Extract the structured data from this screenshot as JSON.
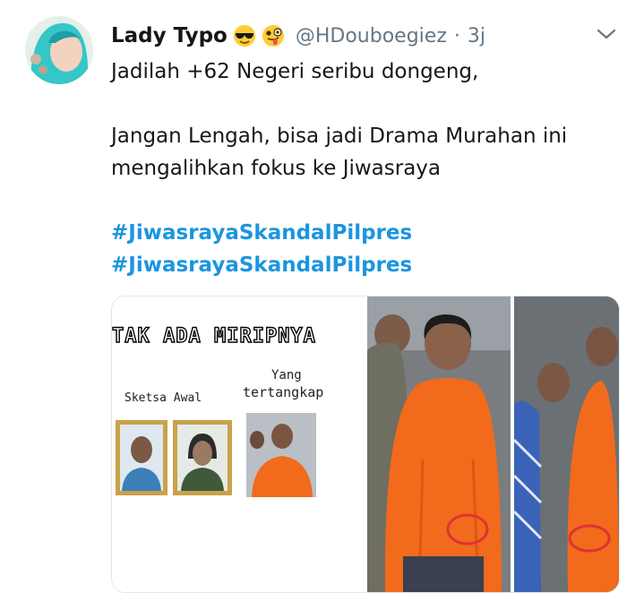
{
  "tweet": {
    "display_name": "Lady Typo",
    "emojis": [
      "sunglasses-emoji",
      "winking-tongue-emoji"
    ],
    "handle": "@HDouboegiez",
    "separator": "·",
    "time": "3j",
    "lines": [
      "Jadilah +62 Negeri seribu dongeng,",
      "",
      "Jangan Lengah, bisa jadi Drama Murahan ini",
      "mengalihkan fokus ke Jiwasraya",
      ""
    ],
    "hashtags": [
      "#JiwasrayaSkandalPilpres",
      "#JiwasrayaSkandalPilpres"
    ]
  },
  "media": {
    "meme_title": "TAK ADA MIRIPNYA",
    "meme_label_left": "Sketsa Awal",
    "meme_label_right_top": "Yang",
    "meme_label_right_bottom": "tertangkap"
  },
  "colors": {
    "accent": "#1b95e0",
    "muted": "#657786",
    "text": "#14171a",
    "frame_gold": "#c9a24a",
    "prisoner_orange": "#f26a1b"
  },
  "icons": {
    "menu": "chevron-down-icon"
  }
}
